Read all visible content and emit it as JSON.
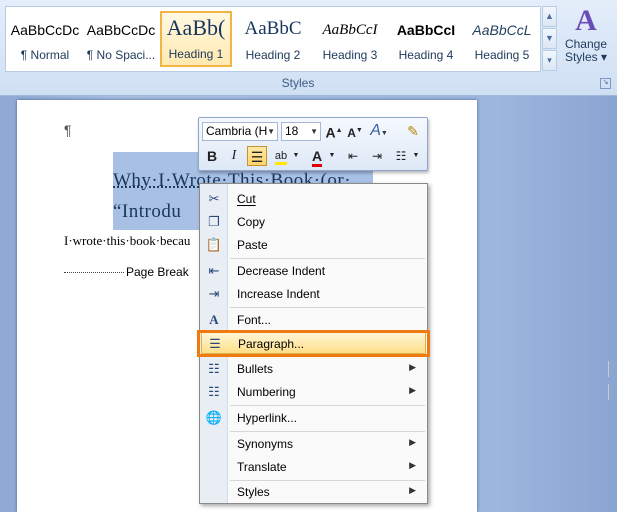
{
  "ribbon": {
    "styles": [
      {
        "sample": "AaBbCcDc",
        "label": "¶ Normal"
      },
      {
        "sample": "AaBbCcDc",
        "label": "¶ No Spaci..."
      },
      {
        "sample": "AaBb(",
        "label": "Heading 1"
      },
      {
        "sample": "AaBbC",
        "label": "Heading 2"
      },
      {
        "sample": "AaBbCcI",
        "label": "Heading 3"
      },
      {
        "sample": "AaBbCcI",
        "label": "Heading 4"
      },
      {
        "sample": "AaBbCcL",
        "label": "Heading 5"
      }
    ],
    "selected_style": "Heading 1",
    "change_styles_label": "Change Styles",
    "change_styles_line1": "Change",
    "change_styles_line2": "Styles ▾",
    "group_label": "Styles"
  },
  "document": {
    "pilcrow": "¶",
    "heading_line1": "Why·I·Wrote·This·Book·(or·",
    "heading_line2": "“Introdu",
    "body_line": "I·wrote·this·book·becau",
    "page_break": "Page Break"
  },
  "mini_toolbar": {
    "font_name": "Cambria (H",
    "font_size": "18",
    "grow_font": "A",
    "shrink_font": "A",
    "styles_btn": "A",
    "bold": "B",
    "italic": "I",
    "font_color_letter": "A"
  },
  "context_menu": {
    "items": [
      {
        "label": "Cut",
        "icon": "scissors-icon"
      },
      {
        "label": "Copy",
        "icon": "copy-icon"
      },
      {
        "label": "Paste",
        "icon": "paste-icon"
      },
      {
        "label": "Decrease Indent",
        "icon": "decrease-indent-icon"
      },
      {
        "label": "Increase Indent",
        "icon": "increase-indent-icon"
      },
      {
        "label": "Font...",
        "icon": "font-icon"
      },
      {
        "label": "Paragraph...",
        "icon": "paragraph-icon"
      },
      {
        "label": "Bullets",
        "icon": "bullets-icon"
      },
      {
        "label": "Numbering",
        "icon": "numbering-icon"
      },
      {
        "label": "Hyperlink...",
        "icon": "hyperlink-icon"
      },
      {
        "label": "Synonyms",
        "icon": ""
      },
      {
        "label": "Translate",
        "icon": ""
      },
      {
        "label": "Styles",
        "icon": ""
      }
    ],
    "highlighted": "Paragraph..."
  },
  "colors": {
    "highlight_box": "#f07a12",
    "selection": "#a8c0e4",
    "heading_text": "#17365d"
  }
}
